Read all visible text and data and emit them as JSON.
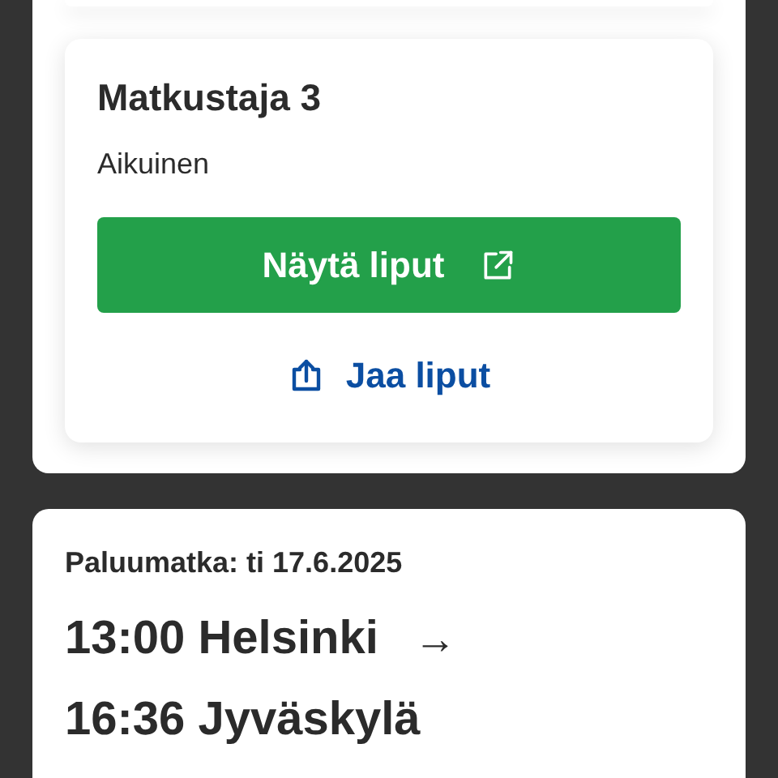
{
  "passenger_card": {
    "title": "Matkustaja 3",
    "type": "Aikuinen",
    "show_button": "Näytä liput",
    "share_link": "Jaa liput"
  },
  "return_trip": {
    "heading": "Paluumatka: ti 17.6.2025",
    "departure": "13:00 Helsinki",
    "arrow": "→",
    "arrival": "16:36 Jyväskylä"
  }
}
